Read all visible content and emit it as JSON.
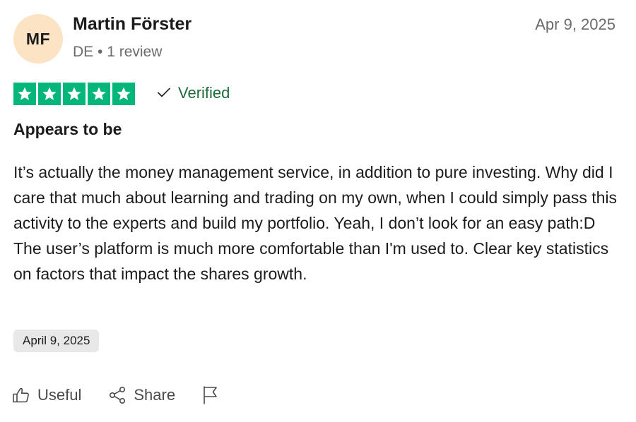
{
  "reviewer": {
    "initials": "MF",
    "name": "Martin Förster",
    "meta": "DE • 1 review",
    "avatar_color": "#fbe3c4"
  },
  "review": {
    "date_top": "Apr 9, 2025",
    "rating": 5,
    "star_color": "#04b67a",
    "verified_label": "Verified",
    "title": "Appears to be",
    "body": "It’s actually the money management service, in addition to pure investing. Why did I care that much about learning and trading on my own, when I could simply pass this activity to the experts and build my portfolio. Yeah, I don’t look for an easy path:D The user’s platform is much more comfortable than I'm used to. Clear key statistics on factors that impact the shares growth.",
    "experience_date": "April 9, 2025"
  },
  "actions": {
    "useful_label": "Useful",
    "share_label": "Share",
    "flag_icon": "flag-icon"
  }
}
